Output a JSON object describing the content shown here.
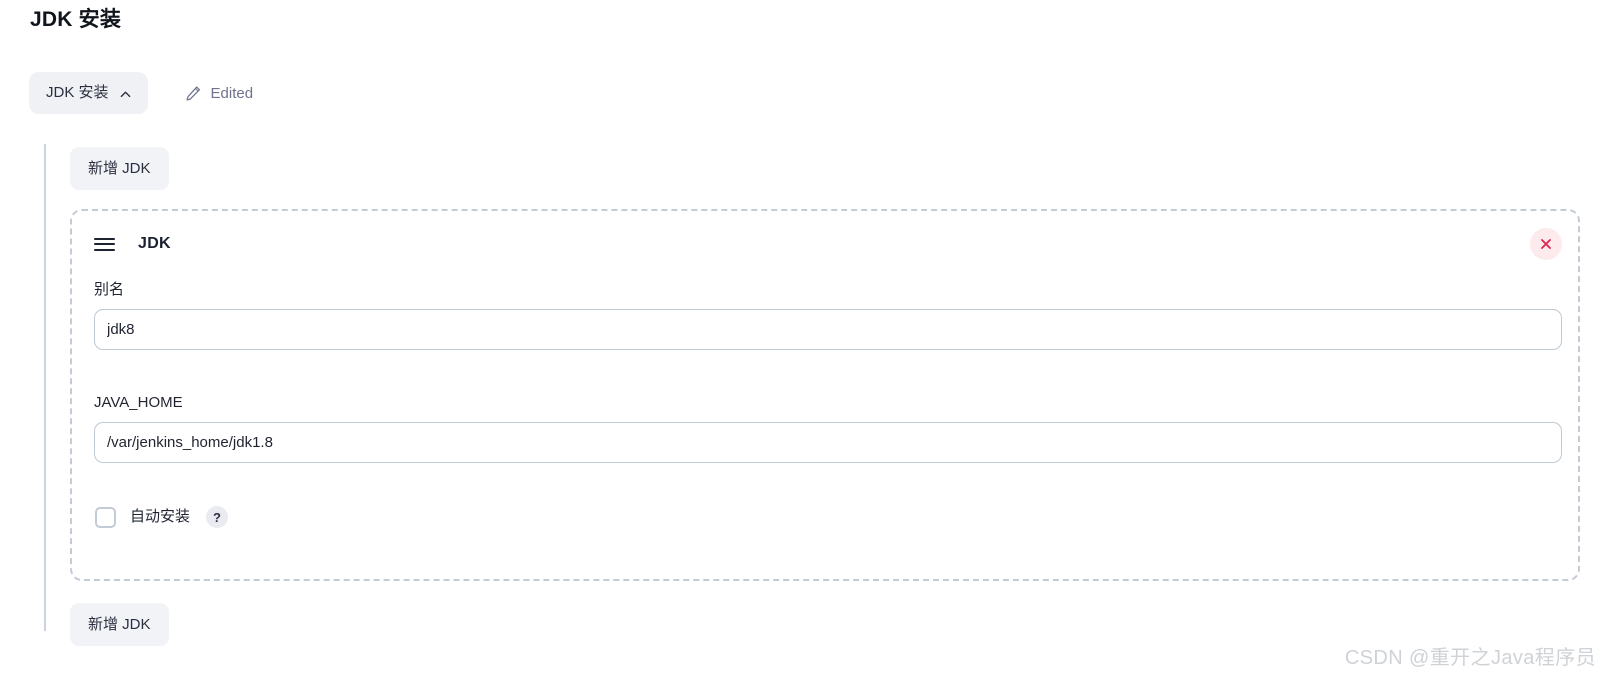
{
  "page": {
    "title": "JDK 安装"
  },
  "section": {
    "collapse_label": "JDK 安装",
    "collapse_icon": "chevron-up-icon",
    "edited_label": "Edited",
    "edited_icon": "pencil-icon"
  },
  "buttons": {
    "add_jdk_top": "新增 JDK",
    "add_jdk_bottom": "新增 JDK"
  },
  "entry": {
    "drag_icon": "drag-handle-icon",
    "title": "JDK",
    "remove_icon": "close-icon",
    "fields": [
      {
        "label": "别名",
        "value": "jdk8",
        "placeholder": ""
      },
      {
        "label": "JAVA_HOME",
        "value": "/var/jenkins_home/jdk1.8",
        "placeholder": ""
      }
    ],
    "checkbox": {
      "label": "自动安装",
      "checked": false,
      "help_label": "?",
      "help_icon": "help-icon"
    }
  },
  "watermark": {
    "text": "CSDN @重开之Java程序员"
  },
  "colors": {
    "accent_danger": "#e0234e",
    "danger_bg": "#fdeaec",
    "pill_bg": "#f0f1f4",
    "border": "#bfc9d3",
    "dashed_border": "#c3ccd6",
    "muted_text": "#6f7390",
    "text": "#1f2430"
  }
}
